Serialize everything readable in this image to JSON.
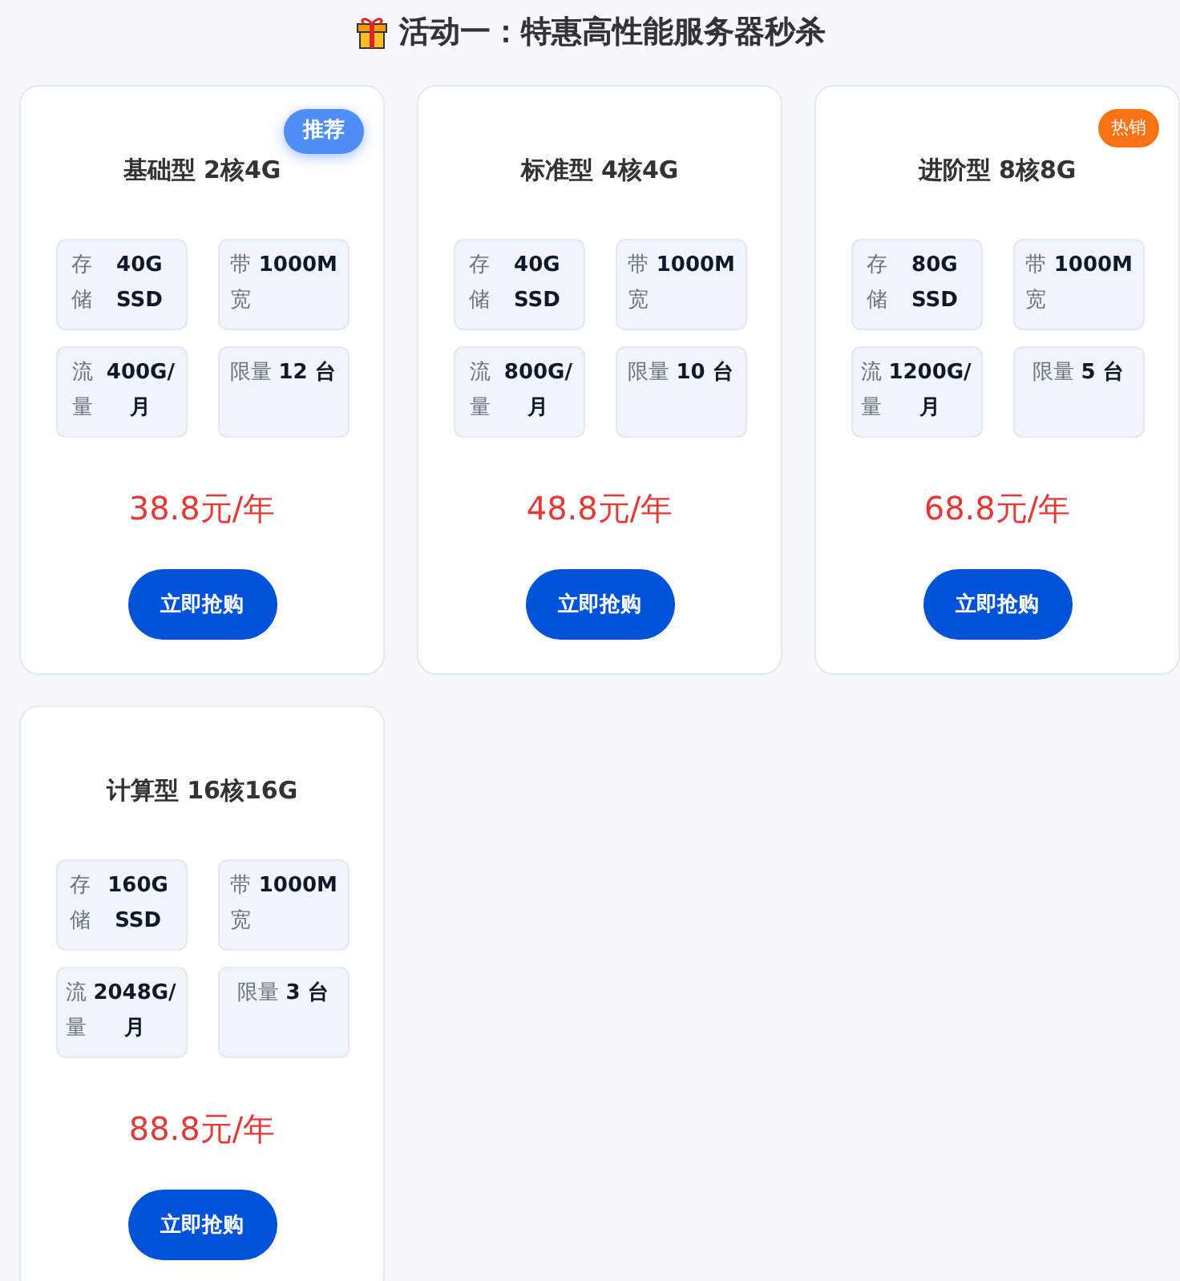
{
  "heading": "活动一：特惠高性能服务器秒杀",
  "plans": [
    {
      "badge": {
        "kind": "recommend",
        "label": "推荐"
      },
      "name": "基础型 2核4G",
      "specs": [
        {
          "label": "存储",
          "value": "40G SSD"
        },
        {
          "label": "带宽",
          "value": "1000M"
        },
        {
          "label": "流量",
          "value": "400G/月"
        },
        {
          "label": "限量",
          "value": "12 台"
        }
      ],
      "price": "38.8元/年",
      "button": "立即抢购"
    },
    {
      "name": "标准型 4核4G",
      "specs": [
        {
          "label": "存储",
          "value": "40G SSD"
        },
        {
          "label": "带宽",
          "value": "1000M"
        },
        {
          "label": "流量",
          "value": "800G/月"
        },
        {
          "label": "限量",
          "value": "10 台"
        }
      ],
      "price": "48.8元/年",
      "button": "立即抢购"
    },
    {
      "badge": {
        "kind": "hot",
        "label": "热销"
      },
      "name": "进阶型 8核8G",
      "specs": [
        {
          "label": "存储",
          "value": "80G SSD"
        },
        {
          "label": "带宽",
          "value": "1000M"
        },
        {
          "label": "流量",
          "value": "1200G/月"
        },
        {
          "label": "限量",
          "value": "5 台"
        }
      ],
      "price": "68.8元/年",
      "button": "立即抢购"
    },
    {
      "name": "计算型 16核16G",
      "specs": [
        {
          "label": "存储",
          "value": "160G SSD"
        },
        {
          "label": "带宽",
          "value": "1000M"
        },
        {
          "label": "流量",
          "value": "2048G/月"
        },
        {
          "label": "限量",
          "value": "3 台"
        }
      ],
      "price": "88.8元/年",
      "button": "立即抢购"
    }
  ]
}
